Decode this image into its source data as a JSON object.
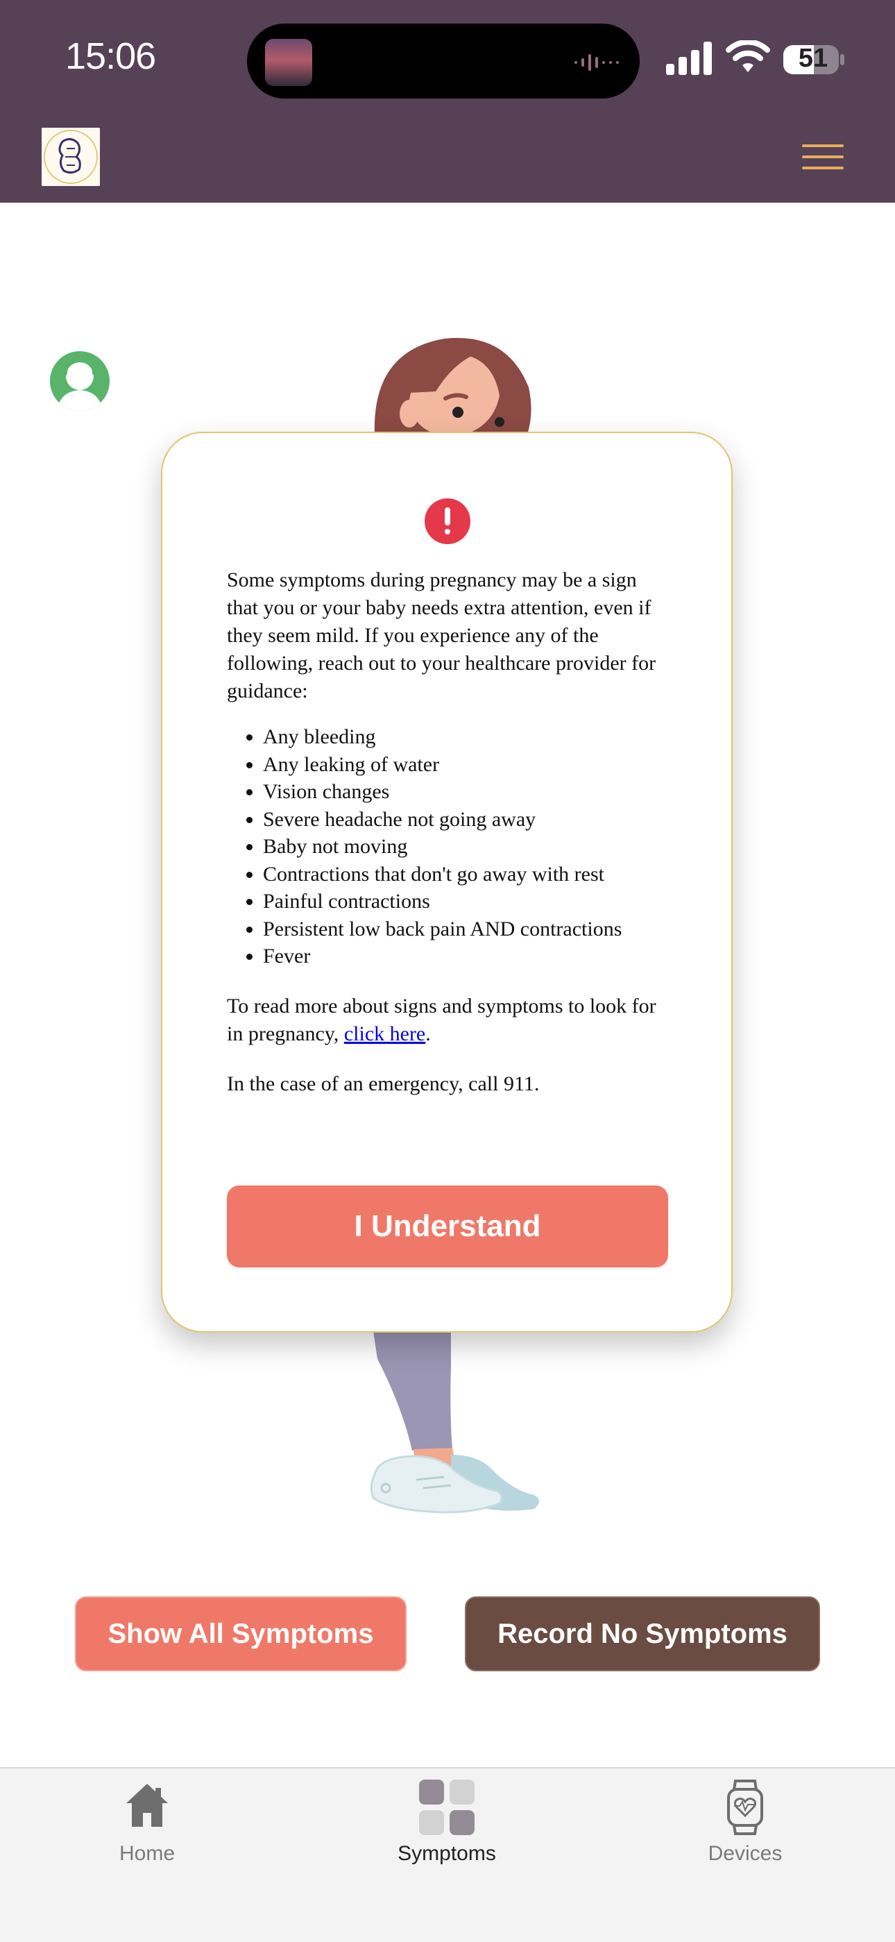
{
  "status_bar": {
    "time": "15:06",
    "battery": "51"
  },
  "header": {
    "logo_icon": "clinic-logo",
    "menu_icon": "hamburger-menu-icon",
    "background_color": "#564157",
    "accent_color": "#e7ae57"
  },
  "modal": {
    "icon": "exclamation-alert-icon",
    "intro": "Some symptoms during pregnancy may be a sign that you or your baby needs extra attention, even if they seem mild. If you experience any of the following, reach out to your healthcare provider for guidance:",
    "symptoms": [
      "Any bleeding",
      "Any leaking of water",
      "Vision changes",
      "Severe headache not going away",
      "Baby not moving",
      "Contractions that don't go away with rest",
      "Painful contractions",
      "Persistent low back pain AND contractions",
      "Fever"
    ],
    "more_prefix": "To read more about signs and symptoms to look for in pregnancy, ",
    "more_link": "click here",
    "more_suffix": ".",
    "emergency": "In the case of an emergency, call 911.",
    "confirm_label": "I Understand",
    "confirm_color": "#ef7868"
  },
  "actions": {
    "show_all_label": "Show All Symptoms",
    "record_none_label": "Record No Symptoms",
    "show_all_color": "#ef7868",
    "record_none_color": "#6a4c42"
  },
  "tabbar": {
    "tabs": [
      {
        "label": "Home",
        "icon": "home-icon"
      },
      {
        "label": "Symptoms",
        "icon": "symptoms-grid-icon",
        "active": true
      },
      {
        "label": "Devices",
        "icon": "smartwatch-icon"
      }
    ]
  }
}
